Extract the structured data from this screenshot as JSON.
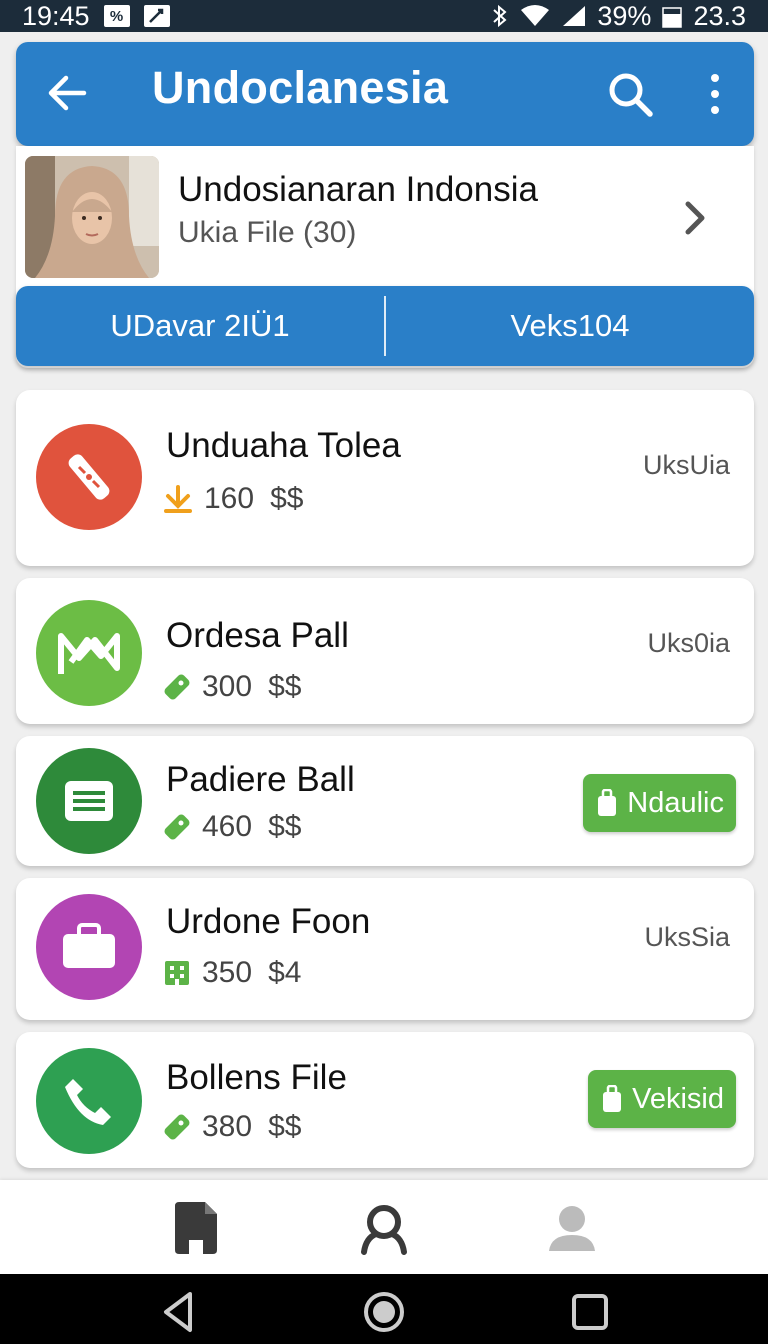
{
  "status_bar": {
    "time": "19:45",
    "battery_percent": "39%",
    "extra": "23.3"
  },
  "app_bar": {
    "title": "Undoclanesia"
  },
  "profile": {
    "name": "Undosianaran Indonsia",
    "subtitle": "Ukia  File (30)",
    "stats": [
      "UDavar 2IÜ1",
      "Veks104"
    ]
  },
  "items": [
    {
      "title": "Unduaha Tolea",
      "value": "160",
      "price": "$$",
      "status": "UksUia",
      "button": "",
      "icon_color": "#e0533d",
      "icon": "phone-handset-icon",
      "meta_icon": "download-arrow-icon"
    },
    {
      "title": "Ordesa Pall",
      "value": "300",
      "price": "$$",
      "status": "Uks0ia",
      "button": "",
      "icon_color": "#6cbd45",
      "icon": "chart-icon",
      "meta_icon": "tag-icon"
    },
    {
      "title": "Padiere Ball",
      "value": "460",
      "price": "$$",
      "status": "",
      "button": "Ndaulic",
      "icon_color": "#2e8a3a",
      "icon": "list-icon",
      "meta_icon": "tag-icon"
    },
    {
      "title": "Urdone Foon",
      "value": "350",
      "price": "$4",
      "status": "UksSia",
      "button": "",
      "icon_color": "#b245b3",
      "icon": "briefcase-icon",
      "meta_icon": "building-icon"
    },
    {
      "title": "Bollens File",
      "value": "380",
      "price": "$$",
      "status": "",
      "button": "Vekisid",
      "icon_color": "#2ea052",
      "icon": "phone-icon",
      "meta_icon": "tag-icon"
    }
  ],
  "colors": {
    "primary": "#2a7fc8",
    "button_green": "#5cb347"
  }
}
